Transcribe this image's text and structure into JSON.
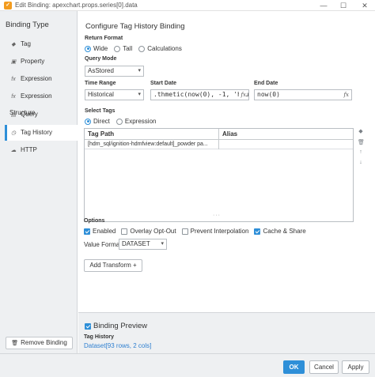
{
  "window": {
    "title": "Edit Binding: apexchart.props.series[0].data",
    "app_icon": "ignition-icon",
    "controls": {
      "minimize": "—",
      "maximize": "☐",
      "close": "✕"
    }
  },
  "sidebar": {
    "title": "Binding Type",
    "items": [
      {
        "label": "Tag",
        "icon": "tag-icon",
        "glyph": "◆"
      },
      {
        "label": "Property",
        "icon": "property-icon",
        "glyph": "▣"
      },
      {
        "label": "Expression",
        "icon": "fx-icon",
        "glyph": "fx"
      },
      {
        "label": "Expression Structure",
        "icon": "fx-icon",
        "glyph": "fx"
      },
      {
        "label": "Query",
        "icon": "query-icon",
        "glyph": "▤"
      },
      {
        "label": "Tag History",
        "icon": "tag-history-icon",
        "glyph": "◷",
        "active": true
      },
      {
        "label": "HTTP",
        "icon": "http-icon",
        "glyph": "☁"
      }
    ],
    "remove_label": "Remove Binding"
  },
  "config": {
    "heading": "Configure Tag History Binding",
    "return_format": {
      "label": "Return Format",
      "options": [
        "Wide",
        "Tall",
        "Calculations"
      ],
      "selected": "Wide"
    },
    "query_mode": {
      "label": "Query Mode",
      "value": "AsStored"
    },
    "time_range": {
      "label": "Time Range",
      "value": "Historical"
    },
    "start_date": {
      "label": "Start Date",
      "value": ".thmetic(now(0), -1, 'hour') *"
    },
    "end_date": {
      "label": "End Date",
      "value": "now(0)"
    },
    "fx_glyph": "fx",
    "select_tags": {
      "label": "Select Tags",
      "options": [
        "Direct",
        "Expression"
      ],
      "selected": "Direct"
    },
    "table": {
      "columns": [
        "Tag Path",
        "Alias"
      ],
      "rows": [
        {
          "tag_path": "[hdm_sql/ignition-hdmfview:default]_powder pa...",
          "alias": ""
        }
      ]
    },
    "table_tools": [
      "add-tag-icon",
      "delete-icon",
      "move-up-icon",
      "move-down-icon"
    ],
    "options": {
      "label": "Options",
      "checks": [
        {
          "label": "Enabled",
          "checked": true
        },
        {
          "label": "Overlay Opt-Out",
          "checked": false
        },
        {
          "label": "Prevent Interpolation",
          "checked": false
        },
        {
          "label": "Cache & Share",
          "checked": true
        }
      ],
      "value_format_label": "Value Format",
      "value_format": "DATASET"
    },
    "add_transform_label": "Add Transform +"
  },
  "preview": {
    "label": "Binding Preview",
    "checked": true,
    "sub_label": "Tag History",
    "value": "Dataset[93 rows, 2 cols]"
  },
  "footer": {
    "ok": "OK",
    "cancel": "Cancel",
    "apply": "Apply"
  },
  "colors": {
    "accent": "#2e8fd8",
    "panel": "#eef0f2",
    "brand": "#f39c1f"
  }
}
